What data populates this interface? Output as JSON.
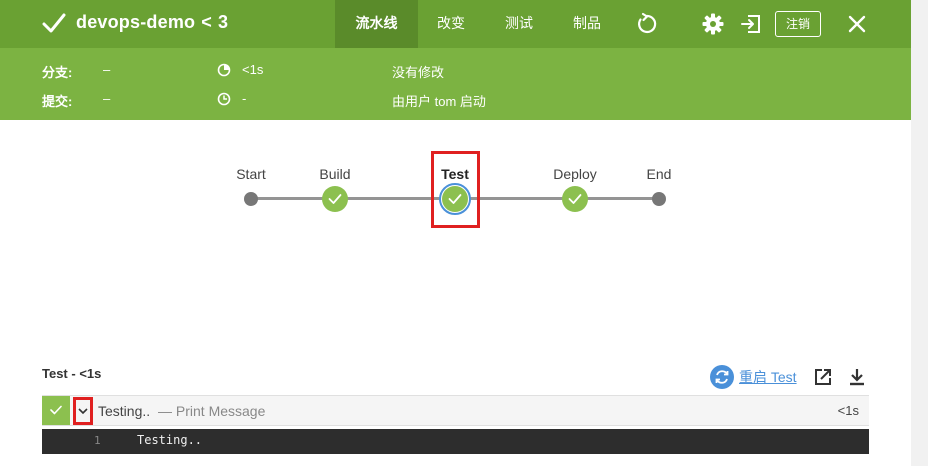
{
  "header": {
    "pipeline_name": "devops-demo",
    "back_symbol": "<",
    "run_number": "3",
    "tabs": [
      {
        "label": "流水线",
        "active": true
      },
      {
        "label": "改变",
        "active": false
      },
      {
        "label": "测试",
        "active": false
      },
      {
        "label": "制品",
        "active": false
      }
    ],
    "logout_label": "注销",
    "colors": {
      "bar": "#6aa133",
      "active_tab": "#5a8b2a",
      "subbar": "#7cb342"
    }
  },
  "summary": {
    "branch_label": "分支:",
    "branch_value": "–",
    "commit_label": "提交:",
    "commit_value": "–",
    "duration_value": "<1s",
    "time_ago_value": "-",
    "changes_text": "没有修改",
    "started_by_text": "由用户 tom 启动"
  },
  "pipeline": {
    "stages": [
      {
        "name": "Start",
        "state": "endpoint"
      },
      {
        "name": "Build",
        "state": "success"
      },
      {
        "name": "Test",
        "state": "success",
        "selected": true
      },
      {
        "name": "Deploy",
        "state": "success"
      },
      {
        "name": "End",
        "state": "endpoint"
      }
    ],
    "colors": {
      "success": "#8cc04f",
      "selected_ring": "#4a90d9",
      "highlight": "#e02020"
    }
  },
  "log": {
    "header": "Test - <1s",
    "restart_label": "重启 Test",
    "step": {
      "name": "Testing..",
      "description": "— Print Message",
      "duration": "<1s"
    },
    "lines": [
      {
        "number": "1",
        "text": "Testing.."
      }
    ]
  }
}
